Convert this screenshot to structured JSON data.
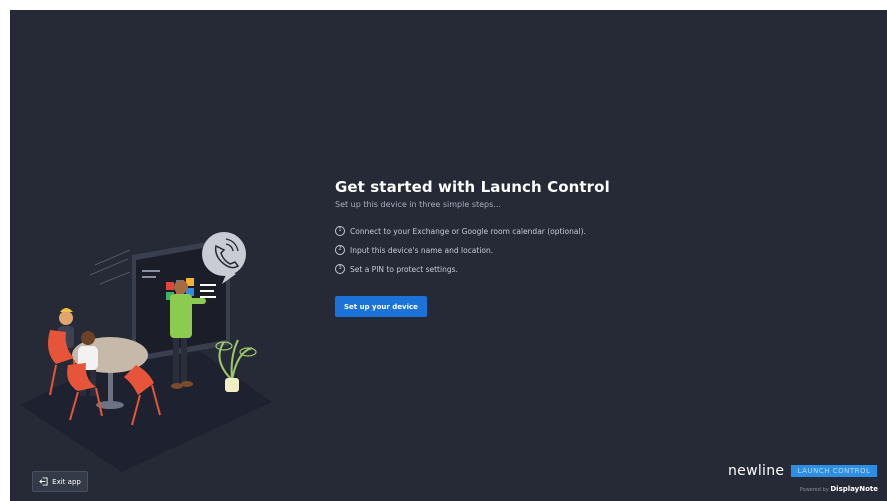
{
  "main": {
    "title": "Get started with Launch Control",
    "subtitle": "Set up this device in three simple steps...",
    "steps": [
      {
        "num": "1",
        "text": "Connect to your Exchange or Google room calendar (optional)."
      },
      {
        "num": "2",
        "text": "Input this device's name and location."
      },
      {
        "num": "3",
        "text": "Set a PIN to protect settings."
      }
    ],
    "setup_button": "Set up your device"
  },
  "footer": {
    "exit_label": "Exit app",
    "exit_icon": "exit-arrow-icon",
    "brand_name": "newline",
    "product_name": "LAUNCH CONTROL",
    "powered_by": "Powered by",
    "powered_brand": "DisplayNote"
  },
  "colors": {
    "background": "#262a37",
    "accent": "#1b72d8",
    "product_badge": "#2d8ee3"
  },
  "illustration": {
    "icon": "phone-call-icon"
  }
}
